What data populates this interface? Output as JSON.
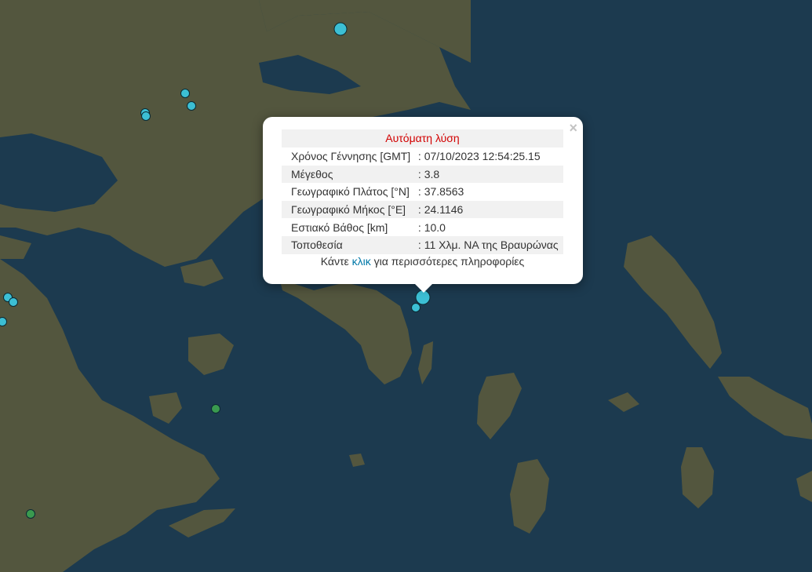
{
  "map": {
    "colors": {
      "sea": "#1c3a4f",
      "land": "#5a5a3c",
      "marker_blue": "#3cbfd4",
      "marker_green": "#3a9a4f"
    },
    "markers": [
      {
        "color": "blue",
        "size": "large"
      },
      {
        "color": "blue",
        "size": "small"
      },
      {
        "color": "blue",
        "size": "small"
      },
      {
        "color": "blue",
        "size": "small"
      },
      {
        "color": "blue",
        "size": "small"
      },
      {
        "color": "blue",
        "size": "small"
      },
      {
        "color": "blue",
        "size": "small"
      },
      {
        "color": "blue",
        "size": "small"
      },
      {
        "color": "blue",
        "size": "large"
      },
      {
        "color": "blue",
        "size": "small"
      },
      {
        "color": "green",
        "size": "small"
      },
      {
        "color": "green",
        "size": "small"
      }
    ]
  },
  "popup": {
    "close_symbol": "×",
    "title": "Αυτόματη λύση",
    "rows": [
      {
        "label": "Χρόνος Γέννησης [GMT]",
        "value": ": 07/10/2023 12:54:25.15"
      },
      {
        "label": "Μέγεθος",
        "value": ": 3.8"
      },
      {
        "label": "Γεωγραφικό Πλάτος [°N]",
        "value": ": 37.8563"
      },
      {
        "label": "Γεωγραφικό Μήκος [°E]",
        "value": ": 24.1146"
      },
      {
        "label": "Εστιακό Βάθος [km]",
        "value": ": 10.0"
      },
      {
        "label": "Τοποθεσία",
        "value": ": 11 Χλμ. ΝΑ της Βραυρώνας"
      }
    ],
    "more_prefix": "Κάντε ",
    "more_link": "κλικ",
    "more_suffix": " για περισσότερες πληροφορίες"
  }
}
